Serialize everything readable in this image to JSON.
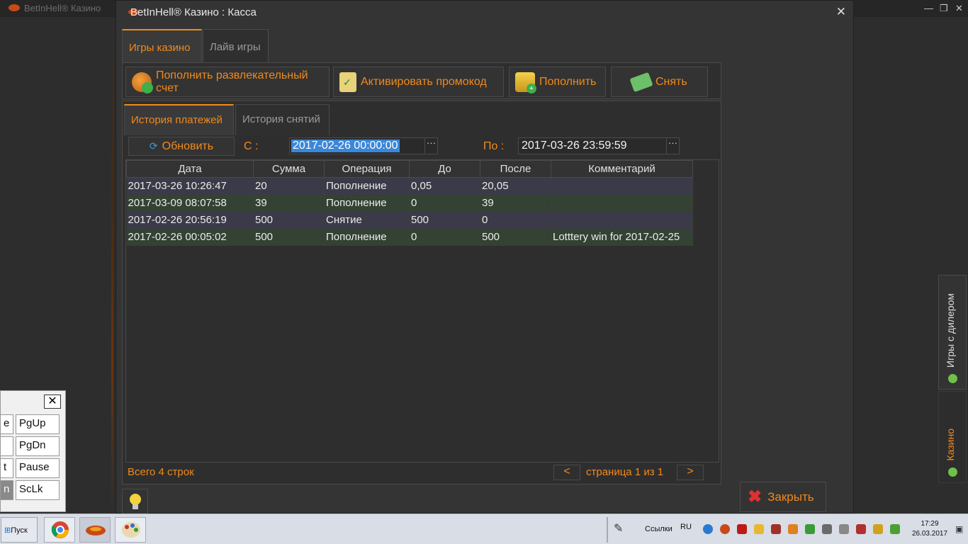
{
  "background_app": {
    "title": "BetInHell® Казино"
  },
  "window": {
    "title": "BetInHell® Казино : Касса"
  },
  "main_tabs": [
    {
      "label": "Игры казино",
      "active": true
    },
    {
      "label": "Лайв игры",
      "active": false
    }
  ],
  "toolbar": {
    "deposit_entertainment": "Пополнить развлекательный счет",
    "activate_promo": "Активировать промокод",
    "deposit": "Пополнить",
    "withdraw": "Снять"
  },
  "sub_tabs": [
    {
      "label": "История платежей",
      "active": true
    },
    {
      "label": "История снятий",
      "active": false
    }
  ],
  "filter": {
    "refresh_label": "Обновить",
    "from_label": "С :",
    "from_value": "2017-02-26 00:00:00",
    "to_label": "По :",
    "to_value": "2017-03-26 23:59:59",
    "picker_label": "···"
  },
  "table": {
    "columns": [
      "Дата",
      "Сумма",
      "Операция",
      "До",
      "После",
      "Комментарий"
    ],
    "rows": [
      [
        "2017-03-26 10:26:47",
        "20",
        "Пополнение",
        "0,05",
        "20,05",
        ""
      ],
      [
        "2017-03-09 08:07:58",
        "39",
        "Пополнение",
        "0",
        "39",
        ""
      ],
      [
        "2017-02-26 20:56:19",
        "500",
        "Снятие",
        "500",
        "0",
        ""
      ],
      [
        "2017-02-26 00:05:02",
        "500",
        "Пополнение",
        "0",
        "500",
        "Lotttery win for 2017-02-25"
      ]
    ]
  },
  "footer": {
    "rows_total": "Всего 4 строк",
    "prev": "<",
    "page_info": "страница 1 из 1",
    "next": ">"
  },
  "close_button": "Закрыть",
  "side_tabs": {
    "dealer_games": "Игры с дилером",
    "casino": "Казино"
  },
  "keyboard": {
    "close": "✕",
    "keys": [
      "e",
      "PgUp",
      "",
      "PgDn",
      "t",
      "Pause",
      "n",
      "ScLk"
    ]
  },
  "taskbar": {
    "start": "Пуск",
    "links": "Ссылки",
    "lang": "RU",
    "time": "17:29",
    "date": "26.03.2017"
  },
  "colors": {
    "accent": "#f08a1c",
    "window_bg": "#343434",
    "row_odd": "#3a3a48",
    "row_even": "#334233"
  }
}
